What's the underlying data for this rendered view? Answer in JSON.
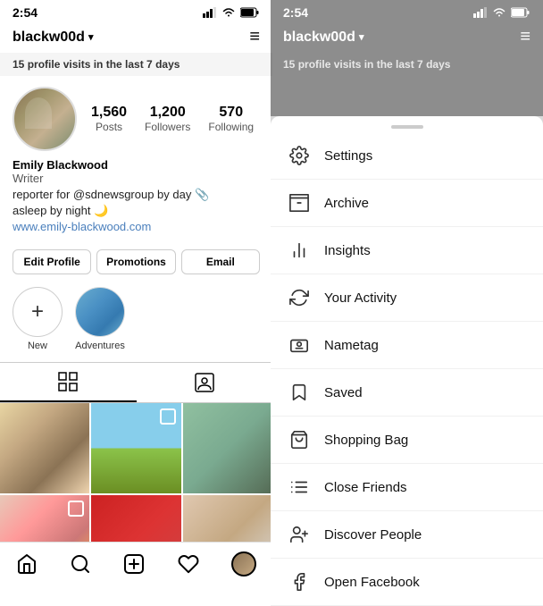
{
  "status_bar": {
    "time": "2:54",
    "signal_icon": "signal-icon",
    "wifi_icon": "wifi-icon",
    "battery_icon": "battery-icon"
  },
  "profile": {
    "username": "blackw00d",
    "username_dropdown": "▾",
    "menu_icon": "≡",
    "profile_visits_count": "15",
    "profile_visits_text": " profile visits in the last 7 days",
    "stats": {
      "posts_count": "1,560",
      "posts_label": "Posts",
      "followers_count": "1,200",
      "followers_label": "Followers",
      "following_count": "570",
      "following_label": "Following"
    },
    "bio": {
      "name": "Emily Blackwood",
      "title": "Writer",
      "description": "reporter for @sdnewsgroup by day 📎\nasleep by night 🌙",
      "website": "www.emily-blackwood.com"
    },
    "buttons": {
      "edit_profile": "Edit Profile",
      "promotions": "Promotions",
      "email": "Email"
    },
    "stories": [
      {
        "label": "New",
        "type": "new"
      },
      {
        "label": "Adventures",
        "type": "adventures"
      }
    ]
  },
  "tabs": {
    "grid_tab": "grid-icon",
    "tag_tab": "tag-icon"
  },
  "bottom_nav": {
    "home": "home-icon",
    "search": "search-icon",
    "add": "add-icon",
    "heart": "heart-icon",
    "profile": "profile-icon"
  },
  "menu": {
    "username": "blackw00d",
    "username_dropdown": "▾",
    "profile_visits_count": "15",
    "profile_visits_text": " profile visits in the last 7 days",
    "items": [
      {
        "id": "settings",
        "label": "Settings",
        "icon": "settings-icon"
      },
      {
        "id": "archive",
        "label": "Archive",
        "icon": "archive-icon"
      },
      {
        "id": "insights",
        "label": "Insights",
        "icon": "insights-icon"
      },
      {
        "id": "your-activity",
        "label": "Your Activity",
        "icon": "activity-icon"
      },
      {
        "id": "nametag",
        "label": "Nametag",
        "icon": "nametag-icon"
      },
      {
        "id": "saved",
        "label": "Saved",
        "icon": "saved-icon"
      },
      {
        "id": "shopping-bag",
        "label": "Shopping Bag",
        "icon": "shopping-icon"
      },
      {
        "id": "close-friends",
        "label": "Close Friends",
        "icon": "friends-icon"
      },
      {
        "id": "discover-people",
        "label": "Discover People",
        "icon": "discover-icon"
      },
      {
        "id": "open-facebook",
        "label": "Open Facebook",
        "icon": "facebook-icon"
      }
    ]
  }
}
